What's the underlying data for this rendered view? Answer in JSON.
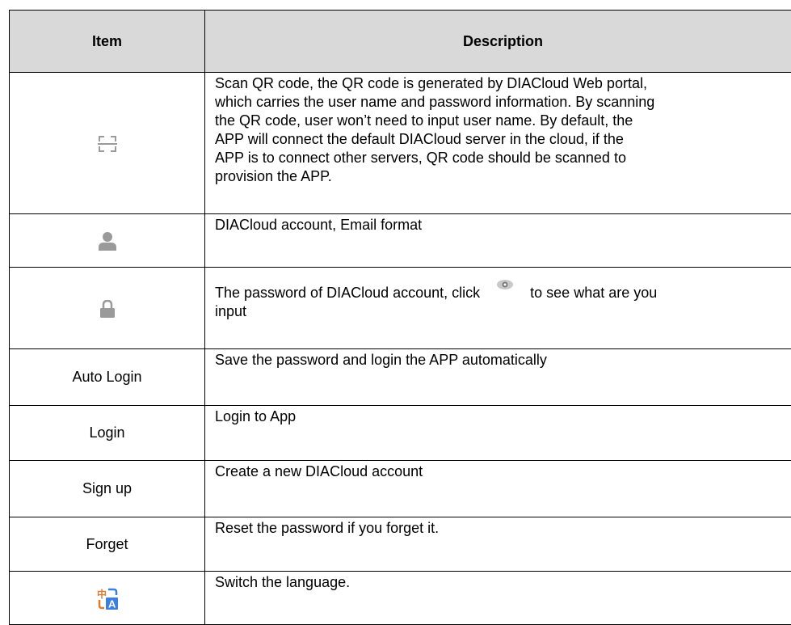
{
  "table": {
    "headers": {
      "item": "Item",
      "description": "Description"
    },
    "rows": [
      {
        "icon": "qr-scan-icon",
        "description_lines": [
          "Scan QR code, the QR code is generated by DIACloud Web portal,",
          "which carries the user name and password information. By scanning",
          "the QR code, user won’t need to input user name. By default, the",
          "APP will connect the default DIACloud server in the cloud, if the",
          "APP is to connect other servers, QR code should be scanned to",
          "provision the APP."
        ]
      },
      {
        "icon": "user-icon",
        "description": "DIACloud account, Email format"
      },
      {
        "icon": "lock-icon",
        "description_before_icon": "The password of DIACloud account, click",
        "inline_icon": "eye-icon",
        "description_after_icon": "to see what are you",
        "description_line2": "input"
      },
      {
        "item": "Auto Login",
        "description": "Save the password and login the APP automatically"
      },
      {
        "item": "Login",
        "description": "Login to App"
      },
      {
        "item": "Sign up",
        "description": "Create a new DIACloud account"
      },
      {
        "item": "Forget",
        "description": "Reset the password if you forget it."
      },
      {
        "icon": "language-switch-icon",
        "icon_glyph": "中",
        "icon_letter": "A",
        "description": "Switch the language."
      }
    ]
  },
  "colors": {
    "header_bg": "#d9d9d9",
    "icon_gray": "#9a9a9a",
    "language_blue": "#3b7fe0",
    "language_orange": "#e07a2e"
  }
}
